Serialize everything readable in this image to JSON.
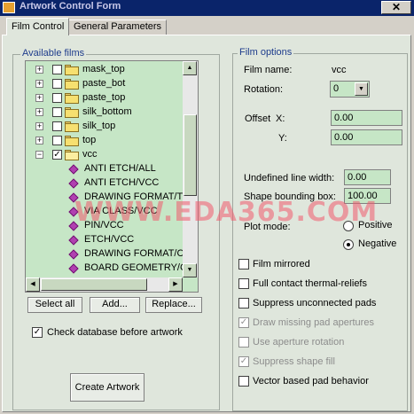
{
  "window": {
    "title": "Artwork Control Form",
    "close_label": "✕"
  },
  "tabs": [
    {
      "label": "Film Control"
    },
    {
      "label": "General Parameters"
    }
  ],
  "available_films": {
    "label": "Available films",
    "items": [
      {
        "label": "mask_top",
        "checked": false
      },
      {
        "label": "paste_bot",
        "checked": false
      },
      {
        "label": "paste_top",
        "checked": false
      },
      {
        "label": "silk_bottom",
        "checked": false
      },
      {
        "label": "silk_top",
        "checked": false
      },
      {
        "label": "top",
        "checked": false
      },
      {
        "label": "vcc",
        "checked": true
      }
    ],
    "subitems": [
      "ANTI ETCH/ALL",
      "ANTI ETCH/VCC",
      "DRAWING FORMAT/T",
      "VIA CLASS/VCC",
      "PIN/VCC",
      "ETCH/VCC",
      "DRAWING FORMAT/C",
      "BOARD GEOMETRY/C"
    ]
  },
  "buttons": {
    "select_all": "Select all",
    "add": "Add...",
    "replace": "Replace...",
    "create_artwork": "Create Artwork"
  },
  "check_database": {
    "label": "Check database before artwork",
    "checked": true
  },
  "film_options": {
    "label": "Film options",
    "film_name_label": "Film name:",
    "film_name_value": "vcc",
    "rotation_label": "Rotation:",
    "rotation_value": "0",
    "offset_label": "Offset",
    "x_label": "X:",
    "x_value": "0.00",
    "y_label": "Y:",
    "y_value": "0.00",
    "undefined_width_label": "Undefined line width:",
    "undefined_width_value": "0.00",
    "shape_bbox_label": "Shape bounding box:",
    "shape_bbox_value": "100.00",
    "plot_mode_label": "Plot mode:",
    "positive_label": "Positive",
    "negative_label": "Negative",
    "plot_mode_selected": "Negative",
    "checkboxes": [
      {
        "label": "Film mirrored",
        "checked": false,
        "enabled": true
      },
      {
        "label": "Full contact thermal-reliefs",
        "checked": false,
        "enabled": true
      },
      {
        "label": "Suppress unconnected pads",
        "checked": false,
        "enabled": true
      },
      {
        "label": "Draw missing pad apertures",
        "checked": true,
        "enabled": false
      },
      {
        "label": "Use aperture rotation",
        "checked": false,
        "enabled": false
      },
      {
        "label": "Suppress shape fill",
        "checked": true,
        "enabled": false
      },
      {
        "label": "Vector based pad behavior",
        "checked": false,
        "enabled": true
      }
    ]
  },
  "watermark": "WWW.EDA365.COM"
}
